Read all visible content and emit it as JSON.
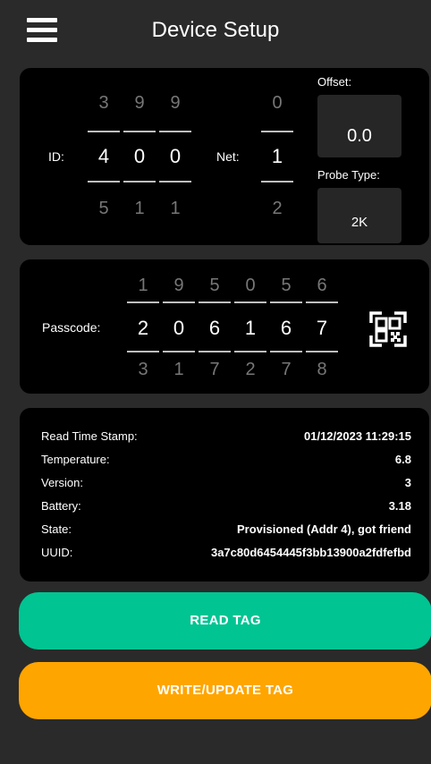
{
  "header": {
    "title": "Device Setup",
    "menu_icon": "hamburger-menu-icon"
  },
  "device_panel": {
    "id_label": "ID:",
    "id_digits": [
      {
        "prev": "3",
        "current": "4",
        "next": "5"
      },
      {
        "prev": "9",
        "current": "0",
        "next": "1"
      },
      {
        "prev": "9",
        "current": "0",
        "next": "1"
      }
    ],
    "net_label": "Net:",
    "net_digit": {
      "prev": "0",
      "current": "1",
      "next": "2"
    },
    "offset_label": "Offset:",
    "offset_value": "0.0",
    "probe_type_label": "Probe Type:",
    "probe_type_value": "2K"
  },
  "passcode_panel": {
    "label": "Passcode:",
    "digits": [
      {
        "prev": "1",
        "current": "2",
        "next": "3"
      },
      {
        "prev": "9",
        "current": "0",
        "next": "1"
      },
      {
        "prev": "5",
        "current": "6",
        "next": "7"
      },
      {
        "prev": "0",
        "current": "1",
        "next": "2"
      },
      {
        "prev": "5",
        "current": "6",
        "next": "7"
      },
      {
        "prev": "6",
        "current": "7",
        "next": "8"
      }
    ],
    "qr_icon": "qr-code-scan-icon"
  },
  "info_panel": {
    "rows": [
      {
        "label": "Read Time Stamp:",
        "value": "01/12/2023 11:29:15"
      },
      {
        "label": "Temperature:",
        "value": "6.8"
      },
      {
        "label": "Version:",
        "value": "3"
      },
      {
        "label": "Battery:",
        "value": "3.18"
      },
      {
        "label": "State:",
        "value": "Provisioned (Addr 4), got friend"
      },
      {
        "label": "UUID:",
        "value": "3a7c80d6454445f3bb13900a2fdfefbd"
      }
    ]
  },
  "buttons": {
    "read_label": "READ TAG",
    "write_label": "WRITE/UPDATE TAG"
  },
  "colors": {
    "background": "#2a2a2a",
    "panel": "#000000",
    "read_button": "#00c492",
    "write_button": "#ffa500"
  }
}
